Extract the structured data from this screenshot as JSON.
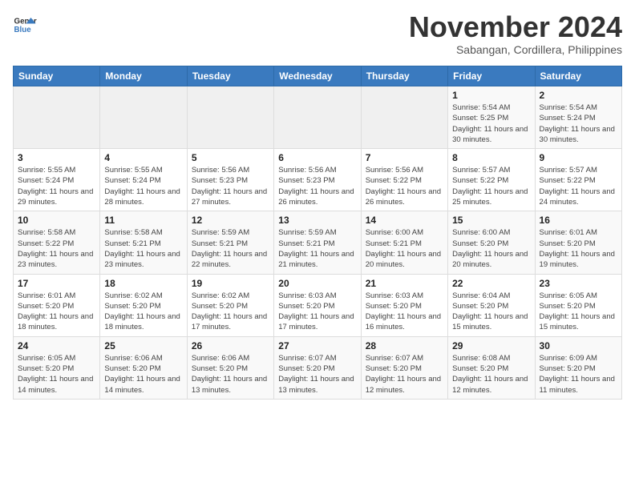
{
  "header": {
    "logo_line1": "General",
    "logo_line2": "Blue",
    "month_title": "November 2024",
    "location": "Sabangan, Cordillera, Philippines"
  },
  "weekdays": [
    "Sunday",
    "Monday",
    "Tuesday",
    "Wednesday",
    "Thursday",
    "Friday",
    "Saturday"
  ],
  "weeks": [
    [
      {
        "day": "",
        "sunrise": "",
        "sunset": "",
        "daylight": ""
      },
      {
        "day": "",
        "sunrise": "",
        "sunset": "",
        "daylight": ""
      },
      {
        "day": "",
        "sunrise": "",
        "sunset": "",
        "daylight": ""
      },
      {
        "day": "",
        "sunrise": "",
        "sunset": "",
        "daylight": ""
      },
      {
        "day": "",
        "sunrise": "",
        "sunset": "",
        "daylight": ""
      },
      {
        "day": "1",
        "sunrise": "Sunrise: 5:54 AM",
        "sunset": "Sunset: 5:25 PM",
        "daylight": "Daylight: 11 hours and 30 minutes."
      },
      {
        "day": "2",
        "sunrise": "Sunrise: 5:54 AM",
        "sunset": "Sunset: 5:24 PM",
        "daylight": "Daylight: 11 hours and 30 minutes."
      }
    ],
    [
      {
        "day": "3",
        "sunrise": "Sunrise: 5:55 AM",
        "sunset": "Sunset: 5:24 PM",
        "daylight": "Daylight: 11 hours and 29 minutes."
      },
      {
        "day": "4",
        "sunrise": "Sunrise: 5:55 AM",
        "sunset": "Sunset: 5:24 PM",
        "daylight": "Daylight: 11 hours and 28 minutes."
      },
      {
        "day": "5",
        "sunrise": "Sunrise: 5:56 AM",
        "sunset": "Sunset: 5:23 PM",
        "daylight": "Daylight: 11 hours and 27 minutes."
      },
      {
        "day": "6",
        "sunrise": "Sunrise: 5:56 AM",
        "sunset": "Sunset: 5:23 PM",
        "daylight": "Daylight: 11 hours and 26 minutes."
      },
      {
        "day": "7",
        "sunrise": "Sunrise: 5:56 AM",
        "sunset": "Sunset: 5:22 PM",
        "daylight": "Daylight: 11 hours and 26 minutes."
      },
      {
        "day": "8",
        "sunrise": "Sunrise: 5:57 AM",
        "sunset": "Sunset: 5:22 PM",
        "daylight": "Daylight: 11 hours and 25 minutes."
      },
      {
        "day": "9",
        "sunrise": "Sunrise: 5:57 AM",
        "sunset": "Sunset: 5:22 PM",
        "daylight": "Daylight: 11 hours and 24 minutes."
      }
    ],
    [
      {
        "day": "10",
        "sunrise": "Sunrise: 5:58 AM",
        "sunset": "Sunset: 5:22 PM",
        "daylight": "Daylight: 11 hours and 23 minutes."
      },
      {
        "day": "11",
        "sunrise": "Sunrise: 5:58 AM",
        "sunset": "Sunset: 5:21 PM",
        "daylight": "Daylight: 11 hours and 23 minutes."
      },
      {
        "day": "12",
        "sunrise": "Sunrise: 5:59 AM",
        "sunset": "Sunset: 5:21 PM",
        "daylight": "Daylight: 11 hours and 22 minutes."
      },
      {
        "day": "13",
        "sunrise": "Sunrise: 5:59 AM",
        "sunset": "Sunset: 5:21 PM",
        "daylight": "Daylight: 11 hours and 21 minutes."
      },
      {
        "day": "14",
        "sunrise": "Sunrise: 6:00 AM",
        "sunset": "Sunset: 5:21 PM",
        "daylight": "Daylight: 11 hours and 20 minutes."
      },
      {
        "day": "15",
        "sunrise": "Sunrise: 6:00 AM",
        "sunset": "Sunset: 5:20 PM",
        "daylight": "Daylight: 11 hours and 20 minutes."
      },
      {
        "day": "16",
        "sunrise": "Sunrise: 6:01 AM",
        "sunset": "Sunset: 5:20 PM",
        "daylight": "Daylight: 11 hours and 19 minutes."
      }
    ],
    [
      {
        "day": "17",
        "sunrise": "Sunrise: 6:01 AM",
        "sunset": "Sunset: 5:20 PM",
        "daylight": "Daylight: 11 hours and 18 minutes."
      },
      {
        "day": "18",
        "sunrise": "Sunrise: 6:02 AM",
        "sunset": "Sunset: 5:20 PM",
        "daylight": "Daylight: 11 hours and 18 minutes."
      },
      {
        "day": "19",
        "sunrise": "Sunrise: 6:02 AM",
        "sunset": "Sunset: 5:20 PM",
        "daylight": "Daylight: 11 hours and 17 minutes."
      },
      {
        "day": "20",
        "sunrise": "Sunrise: 6:03 AM",
        "sunset": "Sunset: 5:20 PM",
        "daylight": "Daylight: 11 hours and 17 minutes."
      },
      {
        "day": "21",
        "sunrise": "Sunrise: 6:03 AM",
        "sunset": "Sunset: 5:20 PM",
        "daylight": "Daylight: 11 hours and 16 minutes."
      },
      {
        "day": "22",
        "sunrise": "Sunrise: 6:04 AM",
        "sunset": "Sunset: 5:20 PM",
        "daylight": "Daylight: 11 hours and 15 minutes."
      },
      {
        "day": "23",
        "sunrise": "Sunrise: 6:05 AM",
        "sunset": "Sunset: 5:20 PM",
        "daylight": "Daylight: 11 hours and 15 minutes."
      }
    ],
    [
      {
        "day": "24",
        "sunrise": "Sunrise: 6:05 AM",
        "sunset": "Sunset: 5:20 PM",
        "daylight": "Daylight: 11 hours and 14 minutes."
      },
      {
        "day": "25",
        "sunrise": "Sunrise: 6:06 AM",
        "sunset": "Sunset: 5:20 PM",
        "daylight": "Daylight: 11 hours and 14 minutes."
      },
      {
        "day": "26",
        "sunrise": "Sunrise: 6:06 AM",
        "sunset": "Sunset: 5:20 PM",
        "daylight": "Daylight: 11 hours and 13 minutes."
      },
      {
        "day": "27",
        "sunrise": "Sunrise: 6:07 AM",
        "sunset": "Sunset: 5:20 PM",
        "daylight": "Daylight: 11 hours and 13 minutes."
      },
      {
        "day": "28",
        "sunrise": "Sunrise: 6:07 AM",
        "sunset": "Sunset: 5:20 PM",
        "daylight": "Daylight: 11 hours and 12 minutes."
      },
      {
        "day": "29",
        "sunrise": "Sunrise: 6:08 AM",
        "sunset": "Sunset: 5:20 PM",
        "daylight": "Daylight: 11 hours and 12 minutes."
      },
      {
        "day": "30",
        "sunrise": "Sunrise: 6:09 AM",
        "sunset": "Sunset: 5:20 PM",
        "daylight": "Daylight: 11 hours and 11 minutes."
      }
    ]
  ]
}
